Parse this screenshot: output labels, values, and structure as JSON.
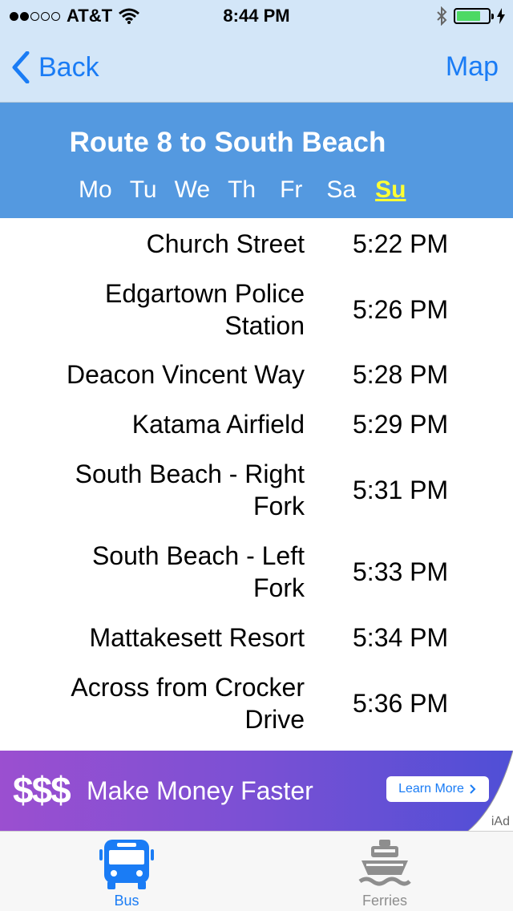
{
  "status_bar": {
    "carrier": "AT&T",
    "time": "8:44 PM",
    "signal_dots_filled": 2,
    "signal_dots_total": 5,
    "battery_level": 0.75
  },
  "nav": {
    "back_label": "Back",
    "map_label": "Map"
  },
  "header": {
    "title": "Route 8 to South Beach",
    "days": [
      {
        "label": "Mo",
        "active": false
      },
      {
        "label": "Tu",
        "active": false
      },
      {
        "label": "We",
        "active": false
      },
      {
        "label": "Th",
        "active": false
      },
      {
        "label": "Fr",
        "active": false
      },
      {
        "label": "Sa",
        "active": false
      },
      {
        "label": "Su",
        "active": true
      }
    ],
    "active_day_color": "#ffff33",
    "background_color": "#5499e0"
  },
  "schedule": [
    {
      "stop": "Church Street",
      "time": "5:22 PM"
    },
    {
      "stop": "Edgartown Police Station",
      "time": "5:26 PM"
    },
    {
      "stop": "Deacon Vincent Way",
      "time": "5:28 PM"
    },
    {
      "stop": "Katama Airfield",
      "time": "5:29 PM"
    },
    {
      "stop": "South Beach - Right Fork",
      "time": "5:31 PM"
    },
    {
      "stop": "South Beach - Left Fork",
      "time": "5:33 PM"
    },
    {
      "stop": "Mattakesett Resort",
      "time": "5:34 PM"
    },
    {
      "stop": "Across from Crocker Drive",
      "time": "5:36 PM"
    }
  ],
  "ad": {
    "dollars": "$$$",
    "text": "Make Money Faster",
    "button_label": "Learn More",
    "badge": "iAd"
  },
  "tabs": [
    {
      "label": "Bus",
      "icon": "bus-icon",
      "active": true
    },
    {
      "label": "Ferries",
      "icon": "ferry-icon",
      "active": false
    }
  ],
  "colors": {
    "accent": "#1a7cf5",
    "bar_background": "#d3e6f8"
  }
}
